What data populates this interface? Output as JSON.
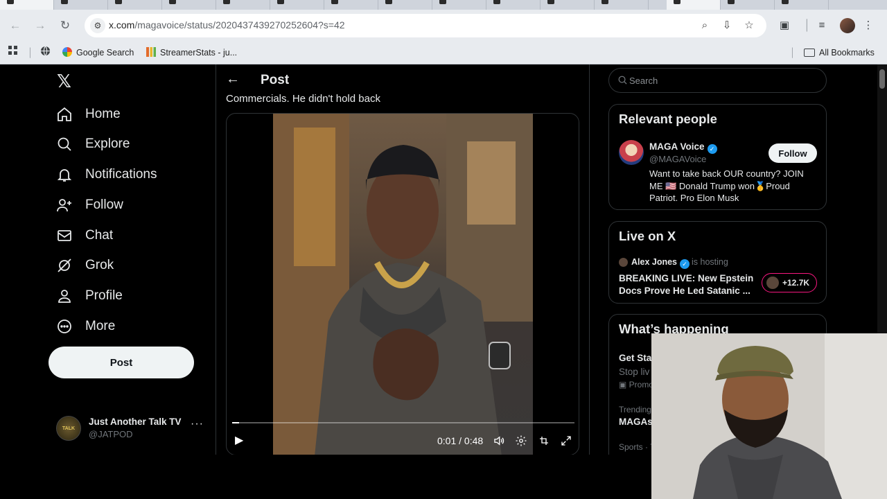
{
  "browser": {
    "url_host": "x.com",
    "url_path": "/magavoice/status/2020437439270252604?s=42",
    "bookmarks": [
      {
        "label": "Google Search"
      },
      {
        "label": "StreamerStats - ju..."
      }
    ],
    "all_bookmarks": "All Bookmarks"
  },
  "sidebar": {
    "items": [
      {
        "label": "Home",
        "icon": "home-icon"
      },
      {
        "label": "Explore",
        "icon": "search-icon"
      },
      {
        "label": "Notifications",
        "icon": "bell-icon"
      },
      {
        "label": "Follow",
        "icon": "person-plus-icon"
      },
      {
        "label": "Chat",
        "icon": "envelope-icon"
      },
      {
        "label": "Grok",
        "icon": "grok-icon"
      },
      {
        "label": "Profile",
        "icon": "person-icon"
      },
      {
        "label": "More",
        "icon": "more-circle-icon"
      }
    ],
    "post_button": "Post",
    "account": {
      "name": "Just Another Talk TV",
      "handle": "@JATPOD",
      "avatar_text": "TALK"
    }
  },
  "main": {
    "header_title": "Post",
    "post_text_partial": "Commercials. He didn't hold back",
    "video": {
      "time": "0:01 / 0:48",
      "progress_fraction": 0.021
    }
  },
  "right": {
    "search_placeholder": "Search",
    "relevant_people": {
      "title": "Relevant people",
      "name": "MAGA Voice",
      "handle": "@MAGAVoice",
      "bio": "Want to take back OUR country? JOIN ME 🇺🇸 Donald Trump won🥇Proud Patriot. Pro Elon Musk",
      "follow_label": "Follow"
    },
    "live": {
      "title": "Live on X",
      "host": "Alex Jones",
      "host_suffix": "is hosting",
      "headline": "BREAKING LIVE: New Epstein Docs Prove He Led Satanic ...",
      "listeners": "+12.7K"
    },
    "whats_happening": {
      "title": "What’s happening",
      "items": [
        {
          "title": "Get Sta",
          "sub": "Stop liv",
          "meta": "Promo"
        },
        {
          "meta": "Trending",
          "title": "MAGAs"
        },
        {
          "meta": "Sports · T"
        }
      ]
    }
  },
  "colors": {
    "accent": "#1d9bf0",
    "live_pink": "#f91880",
    "background": "#000000"
  }
}
